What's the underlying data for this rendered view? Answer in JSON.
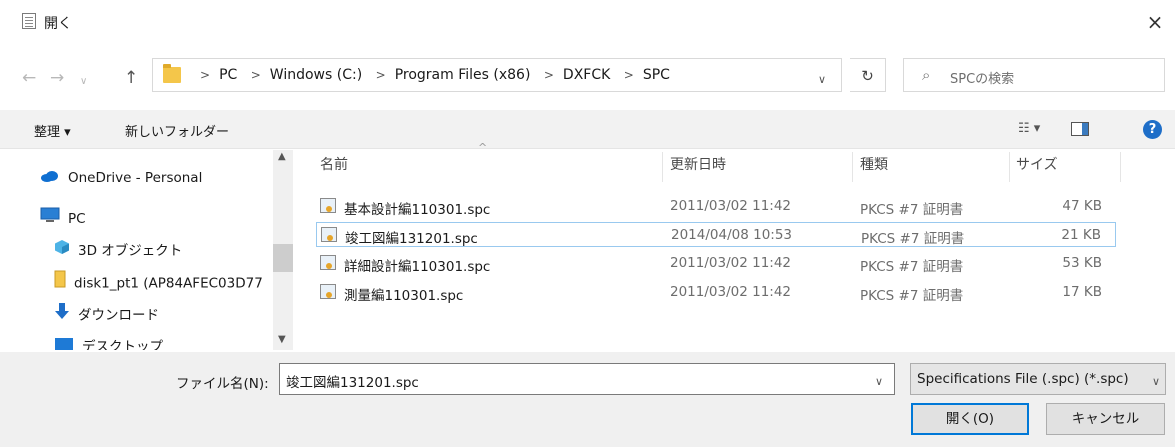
{
  "window": {
    "title": "開く",
    "close_glyph": "×"
  },
  "address": {
    "crumbs": [
      "PC",
      "Windows (C:)",
      "Program Files (x86)",
      "DXFCK",
      "SPC"
    ],
    "separator": ">",
    "search_placeholder": "SPCの検索"
  },
  "toolbar": {
    "organize_label": "整理 ▾",
    "new_folder_label": "新しいフォルダー",
    "view_glyph": "☷ ▾",
    "help_glyph": "?"
  },
  "nav": {
    "items": [
      {
        "label": "OneDrive - Personal",
        "icon": "cloud-icon"
      },
      {
        "label": "PC",
        "icon": "computer-icon"
      },
      {
        "label": "3D オブジェクト",
        "icon": "cube-icon"
      },
      {
        "label": "disk1_pt1 (AP84AFEC03D77",
        "icon": "drive-icon"
      },
      {
        "label": "ダウンロード",
        "icon": "download-icon"
      },
      {
        "label": "デスクトップ",
        "icon": "desktop-icon"
      }
    ]
  },
  "columns": {
    "name": "名前",
    "modified": "更新日時",
    "type": "種類",
    "size": "サイズ"
  },
  "files": [
    {
      "name": "基本設計編110301.spc",
      "modified": "2011/03/02 11:42",
      "type": "PKCS #7 証明書",
      "size": "47 KB"
    },
    {
      "name": "竣工図編131201.spc",
      "modified": "2014/04/08 10:53",
      "type": "PKCS #7 証明書",
      "size": "21 KB"
    },
    {
      "name": "詳細設計編110301.spc",
      "modified": "2011/03/02 11:42",
      "type": "PKCS #7 証明書",
      "size": "53 KB"
    },
    {
      "name": "測量編110301.spc",
      "modified": "2011/03/02 11:42",
      "type": "PKCS #7 証明書",
      "size": "17 KB"
    }
  ],
  "bottom": {
    "filename_label": "ファイル名(N):",
    "filename_value": "竣工図編131201.spc",
    "filetype_value": "Specifications File (.spc) (*.spc)",
    "open_label": "開く(O)",
    "cancel_label": "キャンセル"
  },
  "colors": {
    "accent": "#0078d7",
    "selection_border": "#99c9ef",
    "help": "#1e6ec8",
    "folder": "#f4c64a"
  }
}
